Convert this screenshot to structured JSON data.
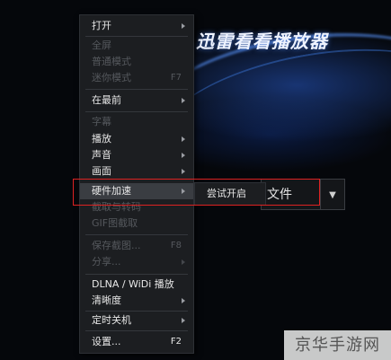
{
  "app": {
    "title": "迅雷看看播放器",
    "open_file_label": "文件"
  },
  "menu": {
    "items": [
      {
        "label": "打开",
        "shortcut": "",
        "submenu": true,
        "enabled": true
      },
      {
        "label": "全屏",
        "shortcut": "",
        "submenu": false,
        "enabled": false
      },
      {
        "label": "普通模式",
        "shortcut": "",
        "submenu": false,
        "enabled": false
      },
      {
        "label": "迷你模式",
        "shortcut": "F7",
        "submenu": false,
        "enabled": false
      },
      {
        "label": "在最前",
        "shortcut": "",
        "submenu": true,
        "enabled": true
      },
      {
        "label": "字幕",
        "shortcut": "",
        "submenu": false,
        "enabled": false
      },
      {
        "label": "播放",
        "shortcut": "",
        "submenu": true,
        "enabled": true
      },
      {
        "label": "声音",
        "shortcut": "",
        "submenu": true,
        "enabled": true
      },
      {
        "label": "画面",
        "shortcut": "",
        "submenu": true,
        "enabled": true
      },
      {
        "label": "硬件加速",
        "shortcut": "",
        "submenu": true,
        "enabled": true,
        "highlighted": true
      },
      {
        "label": "截取与转码",
        "shortcut": "",
        "submenu": false,
        "enabled": false
      },
      {
        "label": "GIF图截取",
        "shortcut": "",
        "submenu": false,
        "enabled": false
      },
      {
        "label": "保存截图...",
        "shortcut": "F8",
        "submenu": false,
        "enabled": false
      },
      {
        "label": "分享...",
        "shortcut": "",
        "submenu": true,
        "enabled": false
      },
      {
        "label": "DLNA / WiDi 播放",
        "shortcut": "",
        "submenu": false,
        "enabled": true
      },
      {
        "label": "清晰度",
        "shortcut": "",
        "submenu": true,
        "enabled": true
      },
      {
        "label": "定时关机",
        "shortcut": "",
        "submenu": true,
        "enabled": true
      },
      {
        "label": "设置...",
        "shortcut": "F2",
        "submenu": false,
        "enabled": true
      }
    ]
  },
  "submenu": {
    "items": [
      {
        "label": "尝试开启"
      }
    ]
  },
  "watermark": "京华手游网",
  "colors": {
    "menu_bg": "#1c1e21",
    "highlight_box": "#dd2222",
    "accent_blue": "#2a5ac8"
  }
}
